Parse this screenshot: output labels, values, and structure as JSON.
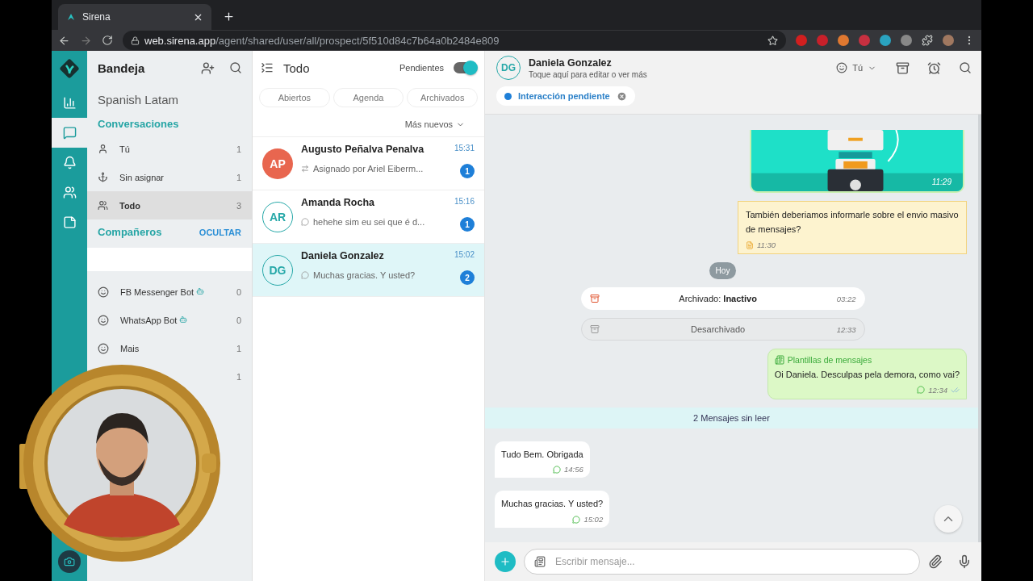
{
  "browser": {
    "tab_title": "Sirena",
    "url_host": "web.sirena.app",
    "url_path": "/agent/shared/user/all/prospect/5f510d84c7b64a0b2484e809"
  },
  "rail": [
    {
      "kind": "stats",
      "selected": false
    },
    {
      "kind": "chat",
      "selected": true
    },
    {
      "kind": "bell",
      "selected": false
    },
    {
      "kind": "team",
      "selected": false
    },
    {
      "kind": "notes",
      "selected": false
    }
  ],
  "sidebar": {
    "title": "Bandeja",
    "account": "Spanish Latam",
    "conversations_heading": "Conversaciones",
    "filters": [
      {
        "kind": "user",
        "label": "Tú",
        "count": "1",
        "selected": false
      },
      {
        "kind": "hook",
        "label": "Sin asignar",
        "count": "1",
        "selected": false
      },
      {
        "kind": "group",
        "label": "Todo",
        "count": "3",
        "selected": true
      }
    ],
    "teammates_heading": "Compañeros",
    "hide_link": "OCULTAR",
    "teammates": [
      {
        "name": "FB Messenger Bot",
        "bot": true,
        "count": "0"
      },
      {
        "name": "WhatsApp Bot",
        "bot": true,
        "count": "0"
      },
      {
        "name": "Mais",
        "bot": false,
        "count": "1"
      },
      {
        "bot": false,
        "count": "1"
      }
    ]
  },
  "list": {
    "title": "Todo",
    "pending_label": "Pendientes",
    "pending_on": true,
    "tabs": [
      "Abiertos",
      "Agenda",
      "Archivados"
    ],
    "sort": "Más nuevos",
    "conversations": [
      {
        "initials": "AP",
        "filled": true,
        "color": "#e8664f",
        "name": "Augusto Peñalva Penalva",
        "time": "15:31",
        "kind": "assigned",
        "preview": "Asignado por Ariel Eiberm...",
        "unread": "1",
        "selected": false
      },
      {
        "initials": "AR",
        "filled": false,
        "color": "#26a8a8",
        "name": "Amanda Rocha",
        "time": "15:16",
        "kind": "whatsapp",
        "preview": "hehehe sim eu sei que é d...",
        "unread": "1",
        "selected": false
      },
      {
        "initials": "DG",
        "filled": false,
        "color": "#26a8a8",
        "name": "Daniela Gonzalez",
        "time": "15:02",
        "kind": "whatsapp",
        "preview": "Muchas gracias. Y usted?",
        "unread": "2",
        "selected": true
      }
    ]
  },
  "chat": {
    "initials": "DG",
    "name": "Daniela Gonzalez",
    "subtitle": "Toque aquí para editar o ver más",
    "assignee": "Tú",
    "tag": "Interacción pendiente",
    "messages": [
      {
        "time": "11:29"
      },
      {
        "kind": "note",
        "text": "También deberiamos informarle sobre el envio masivo de mensajes?",
        "time": "11:30"
      },
      {
        "kind": "date",
        "text": "Hoy"
      },
      {
        "kind": "archived",
        "text": "Archivado: **Inactivo**",
        "time": "03:22"
      },
      {
        "kind": "unarchived",
        "text": "Desarchivado",
        "time": "12:33"
      },
      {
        "kind": "template",
        "header": "Plantillas de mensajes",
        "text": "Oi Daniela. Desculpas pela demora, como vai?",
        "time": "12:34"
      },
      {
        "kind": "divider",
        "text": "2 Mensajes sin leer"
      },
      {
        "kind": "incoming",
        "text": "Tudo Bem. Obrigada",
        "time": "14:56"
      },
      {
        "kind": "incoming",
        "text": "Muchas gracias. Y usted?",
        "time": "15:02"
      }
    ],
    "composer_placeholder": "Escribir mensaje..."
  }
}
